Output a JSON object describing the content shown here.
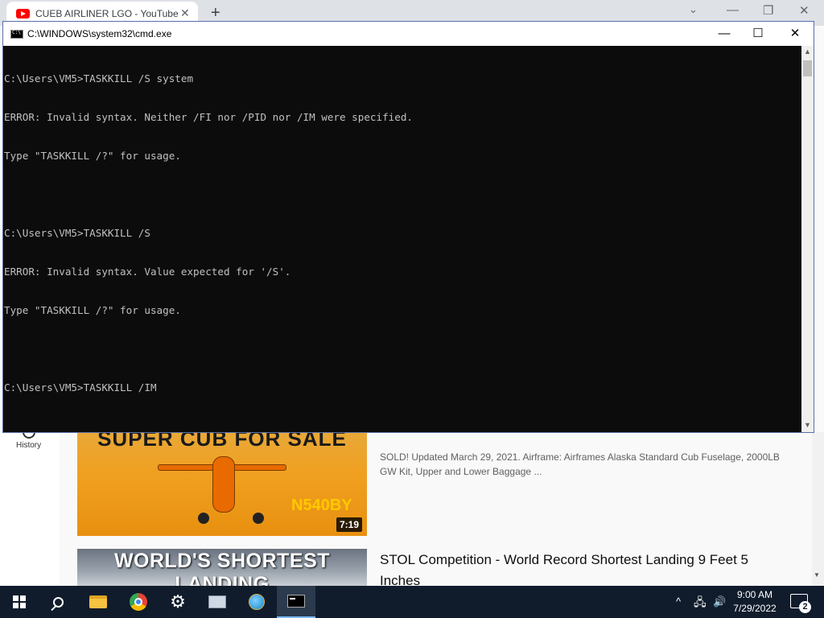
{
  "browser": {
    "tab_title": "CUEB AIRLINER LGO - YouTube",
    "tab_close_glyph": "✕",
    "new_tab_glyph": "+",
    "min_glyph": "—",
    "restore_glyph": "❐",
    "close_glyph": "✕",
    "expand_glyph": "⌄"
  },
  "youtube": {
    "sidebar": {
      "history_label": "History",
      "history_icon": "history-icon"
    },
    "videos": [
      {
        "thumbnail_text": "SUPER CUB FOR SALE",
        "thumbnail_registration": "N540BY",
        "duration": "7:19",
        "description": "SOLD! Updated March 29, 2021. Airframe: Airframes Alaska Standard Cub Fuselage, 2000LB GW Kit, Upper and Lower Baggage ..."
      },
      {
        "thumbnail_text": "WORLD'S SHORTEST LANDING",
        "title": "STOL Competition - World Record Shortest Landing 9 Feet 5 Inches"
      }
    ]
  },
  "cmd": {
    "title": "C:\\WINDOWS\\system32\\cmd.exe",
    "minimize_glyph": "—",
    "maximize_glyph": "☐",
    "close_glyph": "✕",
    "lines": [
      "C:\\Users\\VM5>TASKKILL /S system",
      "ERROR: Invalid syntax. Neither /FI nor /PID nor /IM were specified.",
      "Type \"TASKKILL /?\" for usage.",
      "",
      "C:\\Users\\VM5>TASKKILL /S",
      "ERROR: Invalid syntax. Value expected for '/S'.",
      "Type \"TASKKILL /?\" for usage.",
      "",
      "C:\\Users\\VM5>TASKKILL /IM"
    ]
  },
  "taskbar": {
    "items": [
      "windows-start-icon",
      "search-icon",
      "file-explorer-icon",
      "chrome-icon",
      "settings-icon",
      "network-computer-icon",
      "globe-app-icon",
      "command-prompt-icon"
    ],
    "tray_up_glyph": "^",
    "tray_network_glyph": "🖧",
    "tray_volume_glyph": "🔊",
    "time": "9:00 AM",
    "date": "7/29/2022",
    "notification_count": "2"
  },
  "colors": {
    "console_bg": "#0c0c0c",
    "console_text": "#c0c0c0",
    "taskbar_bg": "#101c2c",
    "youtube_red": "#ff0000"
  }
}
